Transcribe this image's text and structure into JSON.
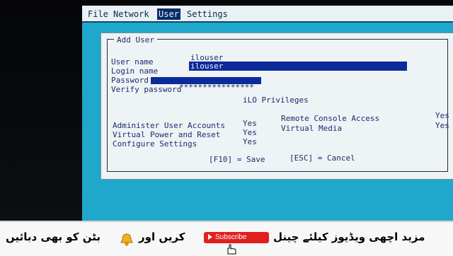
{
  "menu": {
    "items": [
      "File",
      "Network",
      "User",
      "Settings"
    ],
    "active_index": 2
  },
  "dialog": {
    "title": "Add User",
    "fields": [
      {
        "label": "User name",
        "value": "ilouser"
      },
      {
        "label": "Login name",
        "value": "ilouser"
      },
      {
        "label": "Password",
        "value": ""
      },
      {
        "label": "Verify password",
        "value": "****************"
      }
    ],
    "privileges_title": "iLO Privileges",
    "privileges_left": [
      {
        "label": "Administer User Accounts",
        "value": "Yes"
      },
      {
        "label": "Virtual Power and Reset",
        "value": "Yes"
      },
      {
        "label": "Configure Settings",
        "value": "Yes"
      }
    ],
    "privileges_right": [
      {
        "label": "Remote Console Access",
        "value": "Yes"
      },
      {
        "label": "Virtual Media",
        "value": "Yes"
      }
    ],
    "footer_save": "[F10] = Save",
    "footer_cancel": "[ESC] = Cancel"
  },
  "banner": {
    "text_right": "مزید اچھی ویڈیوز کیلئے چینل",
    "subscribe_label": "Subscribe",
    "text_middle": "کریں اور",
    "text_left": "بٹن کو بھی دبائیں"
  },
  "colors": {
    "screen_bg": "#1fa8cc",
    "dialog_bg": "#eef3f6",
    "highlight": "#0c2a9a",
    "subscribe_red": "#e02020"
  }
}
